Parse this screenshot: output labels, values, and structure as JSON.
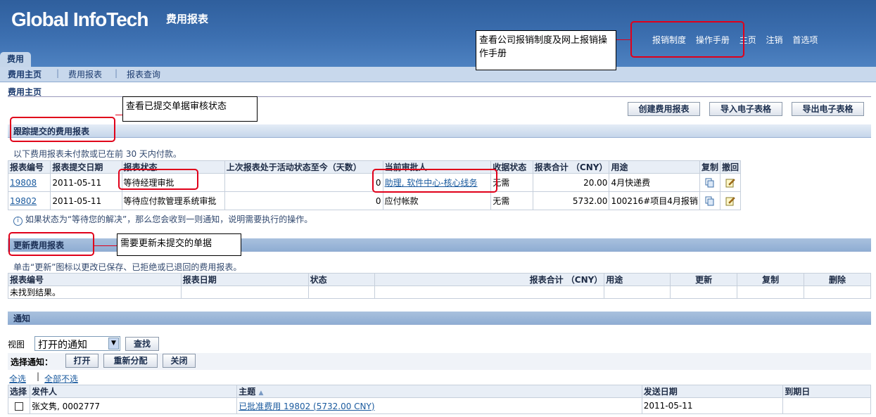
{
  "header": {
    "logo": "Global InfoTech",
    "app_title": "费用报表",
    "global_links": [
      "报销制度",
      "操作手册",
      "主页",
      "注销",
      "首选项"
    ]
  },
  "tab": {
    "label": "费用"
  },
  "subnav": {
    "items": [
      "费用主页",
      "费用报表",
      "报表查询"
    ]
  },
  "breadcrumb": "费用主页",
  "actions": {
    "create": "创建费用报表",
    "import": "导入电子表格",
    "export": "导出电子表格"
  },
  "submitted": {
    "title": "跟踪提交的费用报表",
    "note": "以下费用报表未付款或已在前  30  天内付款。",
    "columns": [
      "报表编号",
      "报表提交日期",
      "报表状态",
      "上次报表处于活动状态至今（天数）",
      "当前审批人",
      "收据状态",
      "报表合计 （CNY）",
      "用途",
      "复制",
      "撤回"
    ],
    "rows": [
      {
        "id": "19808",
        "date": "2011-05-11",
        "status": "等待经理审批",
        "days": "0",
        "approver": "助理, 软件中心-核心线务",
        "receipt": "无需",
        "total": "20.00",
        "purpose": "4月快递费"
      },
      {
        "id": "19802",
        "date": "2011-05-11",
        "status": "等待应付款管理系统审批",
        "days": "0",
        "approver": "应付帐款",
        "receipt": "无需",
        "total": "5732.00",
        "purpose": "100216#项目4月报销"
      }
    ],
    "hint": "如果状态为“等待您的解决”，那么您会收到一则通知，说明需要执行的操作。"
  },
  "update": {
    "title": "更新费用报表",
    "note": "单击“更新”图标以更改已保存、已拒绝或已退回的费用报表。",
    "columns": [
      "报表编号",
      "报表日期",
      "状态",
      "报表合计 （CNY）",
      "用途",
      "更新",
      "复制",
      "删除"
    ],
    "empty": "未找到结果。"
  },
  "notifications": {
    "title": "通知",
    "view_label": "视图",
    "view_value": "打开的通知",
    "search_button": "查找",
    "select_label": "选择通知：",
    "open_button": "打开",
    "reassign_button": "重新分配",
    "close_button": "关闭",
    "select_all": "全选",
    "select_none": "全部不选",
    "columns": [
      "选择",
      "发件人",
      "主题",
      "发送日期",
      "到期日"
    ],
    "rows": [
      {
        "from": "张文隽, 0002777",
        "subject": "已批准费用 19802 (5732.00 CNY)",
        "sent": "2011-05-11",
        "due": ""
      }
    ]
  },
  "annotations": {
    "policy": "查看公司报销制度及网上报销操作手册",
    "status": "查看已提交单据审核状态",
    "update": "需要更新未提交的单据"
  },
  "colors": {
    "header": "#3c6fb0",
    "annotation": "#e0001a",
    "link": "#1a5a9e"
  }
}
